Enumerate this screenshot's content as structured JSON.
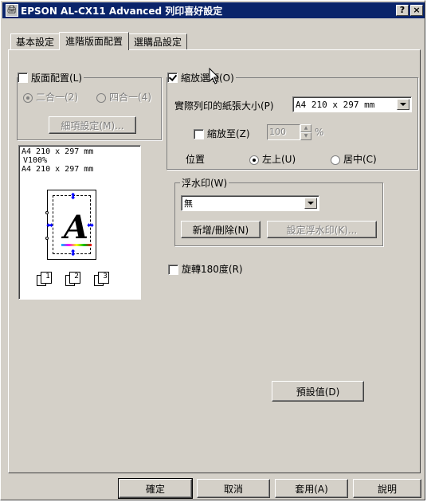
{
  "window": {
    "title": "EPSON AL-CX11 Advanced 列印喜好設定",
    "help_button": "?",
    "close_button": "×"
  },
  "tabs": [
    {
      "label": "基本設定"
    },
    {
      "label": "進階版面配置",
      "active": true
    },
    {
      "label": "選購品設定"
    }
  ],
  "layout": {
    "checkbox_label": "版面配置(L)",
    "checked": false,
    "radio_2up": "二合一(2)",
    "radio_4up": "四合一(4)",
    "details_button": "細項設定(M)..."
  },
  "preview": {
    "line1": "A4 210 x 297 mm",
    "line2": "V100%",
    "line3": "A4 210 x 297 mm",
    "page_icons": [
      "1",
      "2",
      "3"
    ]
  },
  "zoom": {
    "checkbox_label": "縮放選項(O)",
    "checked": true,
    "paper_size_label": "實際列印的紙張大小(P)",
    "paper_size_value": "A4 210 x 297 mm",
    "scale_label": "縮放至(Z)",
    "scale_value": "100",
    "scale_unit": "%",
    "position_label": "位置",
    "pos_top_left": "左上(U)",
    "pos_center": "居中(C)"
  },
  "watermark": {
    "group_label": "浮水印(W)",
    "selected_value": "無",
    "add_delete_button": "新增/刪除(N)",
    "settings_button": "設定浮水印(K)..."
  },
  "rotate": {
    "checkbox_label": "旋轉180度(R)",
    "checked": false
  },
  "defaults_button": "預設值(D)",
  "footer": {
    "ok": "確定",
    "cancel": "取消",
    "apply": "套用(A)",
    "help": "說明"
  }
}
